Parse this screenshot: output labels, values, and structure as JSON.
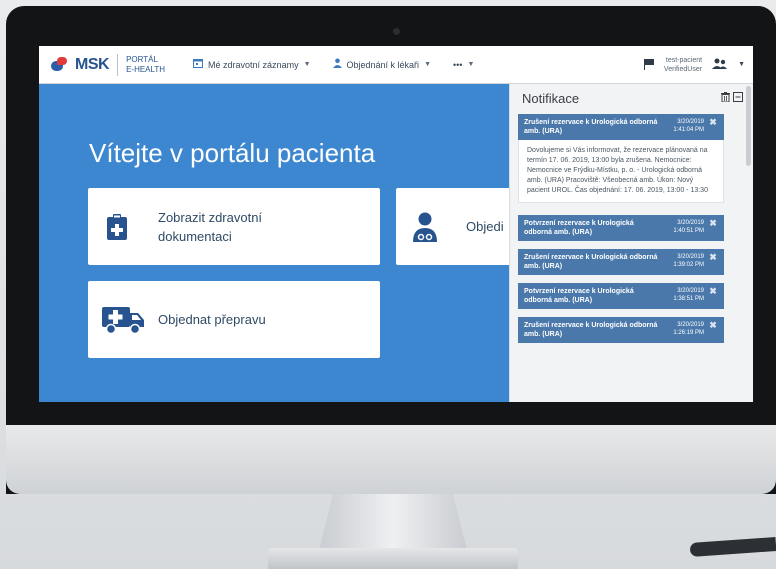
{
  "header": {
    "logo_text": "MSK",
    "portal_line1": "PORTÁL",
    "portal_line2": "E-HEALTH",
    "menu": [
      {
        "label": "Mé zdravotní záznamy",
        "icon": "calendar-icon"
      },
      {
        "label": "Objednání k lékaři",
        "icon": "person-icon"
      },
      {
        "label": "•••",
        "icon": ""
      }
    ],
    "user_line1": "test-pacient",
    "user_line2": "VerifiedUser"
  },
  "main": {
    "welcome": "Vítejte v portálu pacienta",
    "cards": [
      {
        "label_line1": "Zobrazit zdravotní",
        "label_line2": "dokumentaci",
        "icon": "medical-clipboard-icon"
      },
      {
        "label_line1": "Objedi",
        "label_line2": "",
        "icon": "doctor-icon"
      },
      {
        "label_line1": "Objednat přepravu",
        "label_line2": "",
        "icon": "ambulance-icon"
      }
    ]
  },
  "notifications": {
    "title": "Notifikace",
    "items": [
      {
        "title": "Zrušení rezervace k Urologická odborná amb. (URA)",
        "date": "3/20/2019",
        "time": "1:41:04 PM",
        "body": "Dovolujeme si Vás informovat, že rezervace plánovaná na termín 17. 06. 2019, 13:00 byla zrušena. Nemocnice: Nemocnice ve Frýdku-Místku, p. o. - Urologická odborná amb. (URA) Pracoviště: Všeobecná amb. Úkon: Nový pacient UROL. Čas objednání: 17. 06. 2019, 13:00 - 13:30"
      },
      {
        "title": "Potvrzení rezervace k Urologická odborná amb. (URA)",
        "date": "3/20/2019",
        "time": "1:40:51 PM",
        "body": ""
      },
      {
        "title": "Zrušení rezervace k Urologická odborná amb. (URA)",
        "date": "3/20/2019",
        "time": "1:39:02 PM",
        "body": ""
      },
      {
        "title": "Potvrzení rezervace k Urologická odborná amb. (URA)",
        "date": "3/20/2019",
        "time": "1:38:51 PM",
        "body": ""
      },
      {
        "title": "Zrušení rezervace k Urologická odborná amb. (URA)",
        "date": "3/20/2019",
        "time": "1:26:19 PM",
        "body": ""
      }
    ]
  },
  "colors": {
    "accent": "#3d87d1",
    "notif_header": "#4a78ab"
  }
}
